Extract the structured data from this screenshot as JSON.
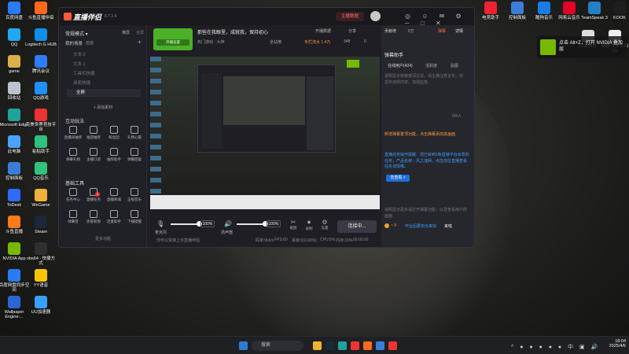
{
  "desktop_left": [
    {
      "label": "百度网盘",
      "color": "#2a7cf6"
    },
    {
      "label": "斗鱼直播伴侣",
      "color": "#ff6a1a"
    },
    {
      "label": "QQ",
      "color": "#1eaaf1"
    },
    {
      "label": "Logitech G HUB",
      "color": "#0d8ee9"
    },
    {
      "label": "game",
      "color": "#d9b04a"
    },
    {
      "label": "腾讯会议",
      "color": "#2f7cf7"
    },
    {
      "label": "回收站",
      "color": "#bcc3cc"
    },
    {
      "label": "QQ游戏",
      "color": "#1e90ff"
    },
    {
      "label": "Microsoft Edge",
      "color": "#1fa39a"
    },
    {
      "label": "完美世界竞技平台",
      "color": "#e33"
    },
    {
      "label": "此电脑",
      "color": "#4aa3ff"
    },
    {
      "label": "粘贴助手",
      "color": "#2ec27e"
    },
    {
      "label": "控制面板",
      "color": "#3b7dd8"
    },
    {
      "label": "QQ音乐",
      "color": "#31c27c"
    },
    {
      "label": "ToDesk",
      "color": "#2f6bff"
    },
    {
      "label": "WeGame",
      "color": "#f1b13a"
    },
    {
      "label": "斗鱼直播",
      "color": "#ff7a1a"
    },
    {
      "label": "Steam",
      "color": "#1b2838"
    },
    {
      "label": "NVIDIA App",
      "color": "#76b900"
    },
    {
      "label": "obs64 - 快捷方式",
      "color": "#302e31"
    },
    {
      "label": "百度网盘同步空间",
      "color": "#2a7cf6"
    },
    {
      "label": "YY语音",
      "color": "#f7c600"
    },
    {
      "label": "Wallpaper Engine:...",
      "color": "#2b66d6"
    },
    {
      "label": "UU加速器",
      "color": "#3aa0ff"
    }
  ],
  "desktop_right": [
    {
      "label": "电竞助手",
      "color": "#e23"
    },
    {
      "label": "控制面板",
      "color": "#3b7dd8"
    },
    {
      "label": "酷狗音乐",
      "color": "#1a7ce8"
    },
    {
      "label": "网易云音乐",
      "color": "#e60026"
    },
    {
      "label": "TeamSpeak 3",
      "color": "#2580c3"
    },
    {
      "label": "KOOK",
      "color": "#1e1e1e"
    },
    {
      "label": "口袋评价",
      "color": "#ddd"
    },
    {
      "label": "新建 文本文档 (2)",
      "color": "#eee"
    }
  ],
  "nvidia_toast": "点击 Alt+Z，打开 NVIDIA 叠加层",
  "app": {
    "name": "直播伴侣",
    "version": "6.7.2.4",
    "live_badge": "主播数据",
    "title": "那些在我眼里，成就我，保持初心",
    "tag": "热门游戏 - 大神",
    "share": "分享",
    "open_live": "开播设置",
    "stats": {
      "fans": "全站榜",
      "hot": "专栏流水 1.4万",
      "like": "348",
      "online": "0",
      "gift_label": "贡献榜",
      "gift_value": "0万",
      "danmu": "弹幕",
      "detail": "详情"
    },
    "left": {
      "mode_label": "常规模式",
      "mode_tabs": [
        "横屏",
        "全屏"
      ],
      "scene_header": "我的场景",
      "scene_sub": "画面",
      "scenes": [
        "文本 2",
        "文本 1",
        "工具栏快捷",
        "桌面快捷"
      ],
      "active_scene": "全屏",
      "add_source": "+ 添加素材",
      "interact_title": "互动玩法",
      "interact": [
        "直播间抽奖",
        "福袋抽奖",
        "粉丝团",
        "礼物心愿",
        "弹幕礼物",
        "主播口袋",
        "抽奖助手",
        "弹幕回复"
      ],
      "tools_title": "基础工具",
      "tools": [
        "任务中心",
        "直播任务",
        "直播商城",
        "正规音乐",
        "弹幕音",
        "房管权限",
        "连麦助手",
        "下播提醒"
      ],
      "tools_badge": "1",
      "more": "更多功能"
    },
    "audio": {
      "mic_label": "麦克风",
      "mic_pct": "100%",
      "mic_level": 1.0,
      "speaker_label": "扬声器",
      "speaker_pct": "100%",
      "speaker_level": 1.0
    },
    "ctrl": [
      "截图",
      "录制",
      "设置"
    ],
    "connect": "连接中...",
    "status": {
      "hint": "你可以快速上手直播伴侣",
      "bitrate": "码率:0kb/s",
      "fps": "FPS:60",
      "drop": "丢帧:0(0.00%)",
      "cpu": "CPU:5%",
      "mem": "内存:15%",
      "time": "00:00:00"
    },
    "right": {
      "title": "弹幕助手",
      "tabs": [
        "在线用户(424)",
        "活跃度",
        "贴图"
      ],
      "notice": "说明显示有敏感词过滤，请主播注意言论，勿发布违规内容，加强监管。",
      "notice2": "新增弹幕置顶功能，点击弹幕添加进画面",
      "notice3": "直播任务操作提醒：您已收到1条直播平台派发的任务，产品名称：风之谜网，点击前往直播查看任务详情哦。",
      "view_btn": "去查看 >",
      "help": "说明显示更多请打开弹幕功能，以及查看用户的画面",
      "user_badge": "~ 9",
      "user_name": "毕业后要去出来找",
      "user_msg": "来啦",
      "count": "0/9人"
    }
  },
  "taskbar": {
    "search": "搜索",
    "time": "18:04",
    "date": "2025/4/6"
  }
}
